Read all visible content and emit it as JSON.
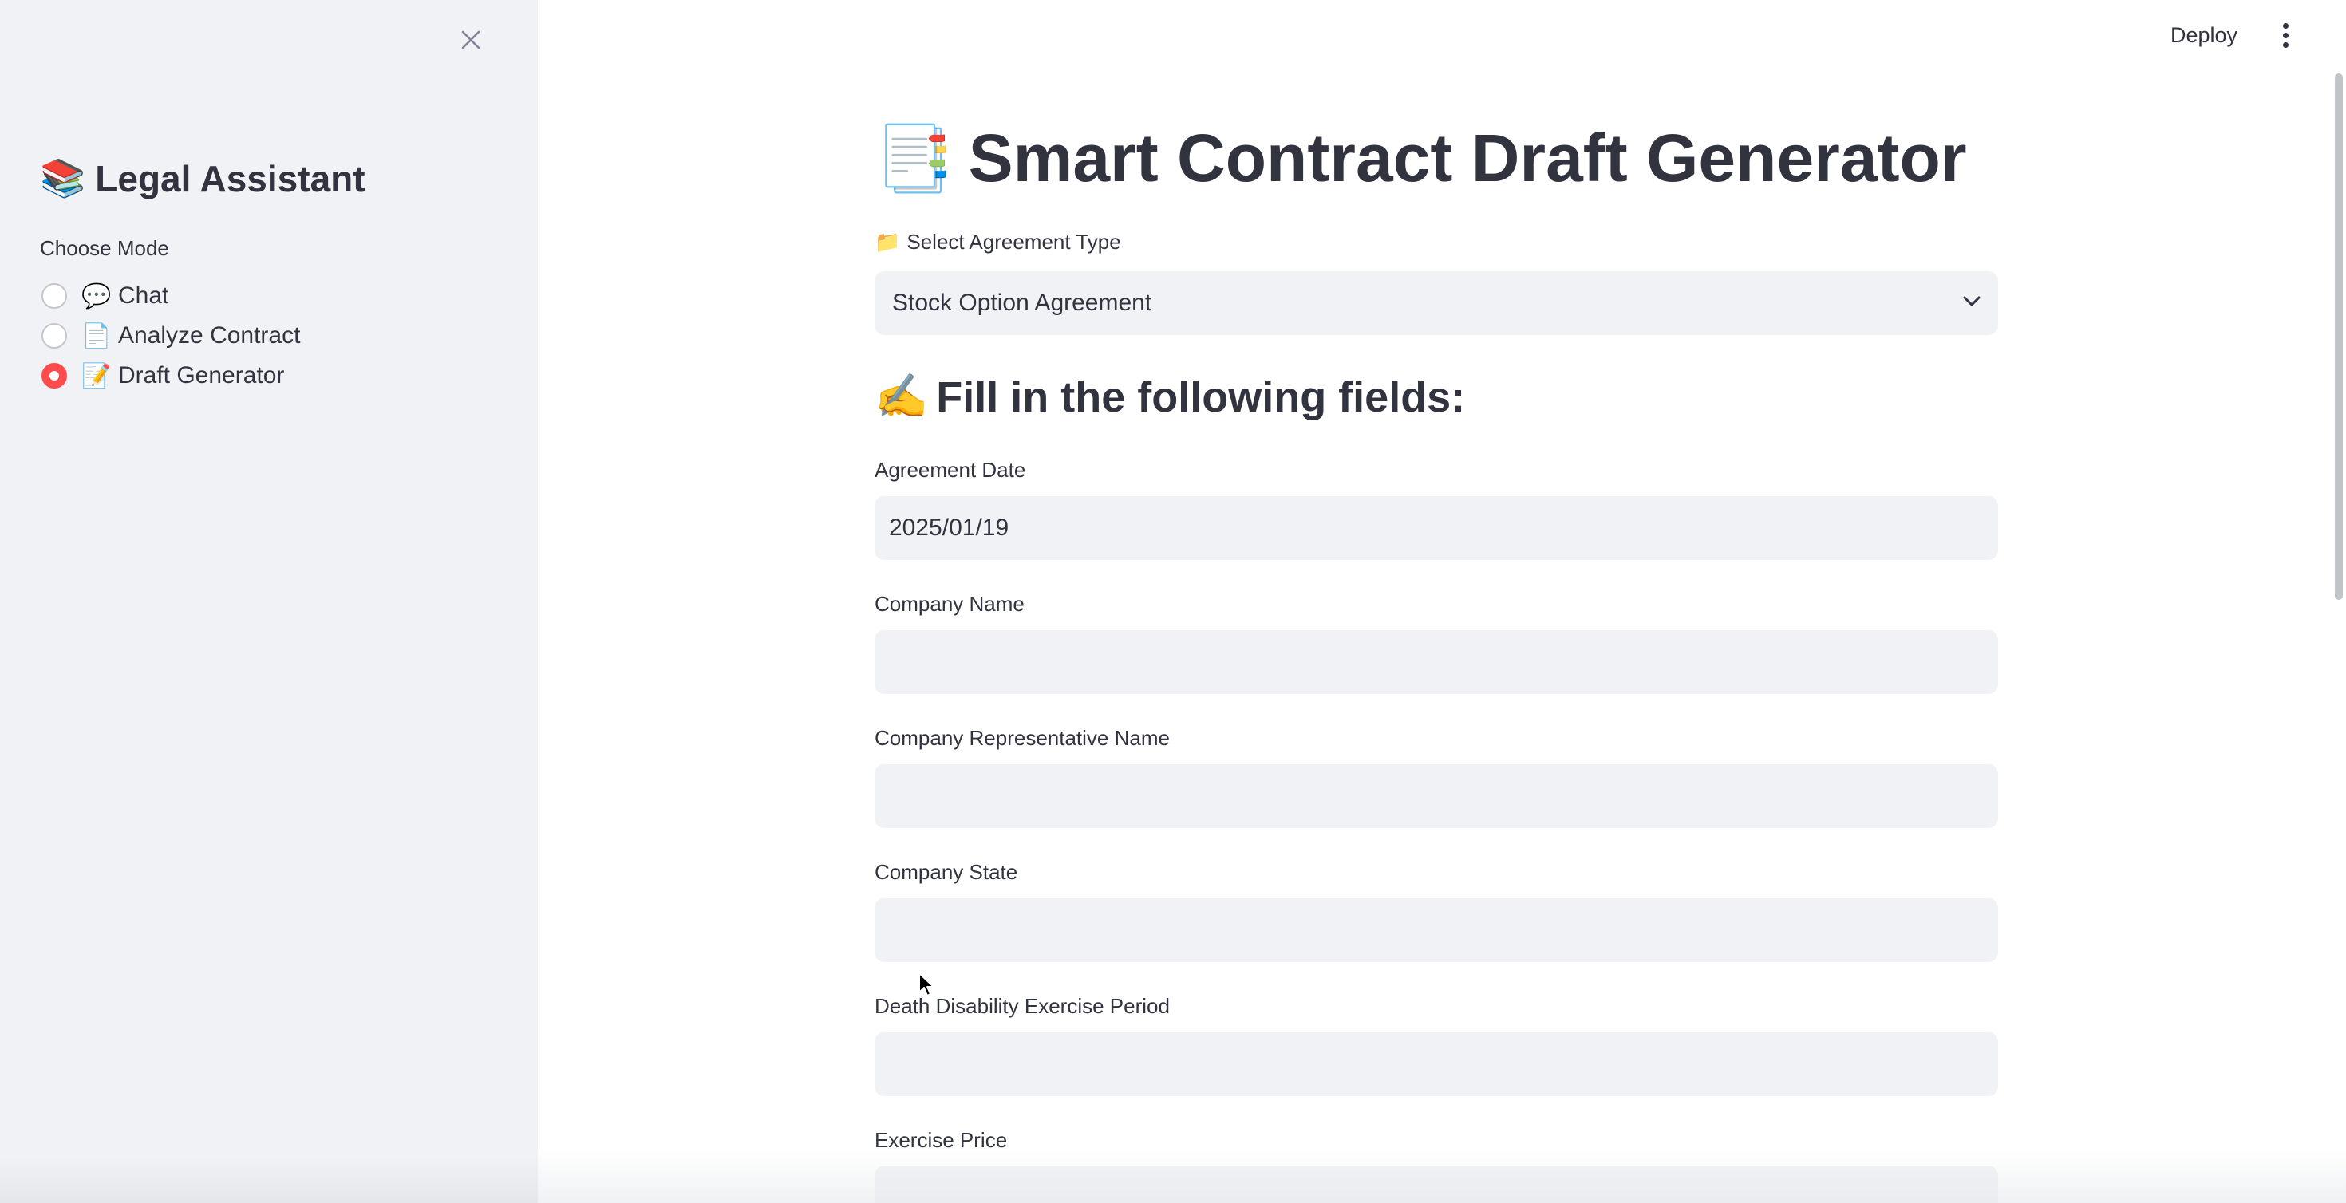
{
  "sidebar": {
    "title_emoji": "📚",
    "title": "Legal Assistant",
    "mode_label": "Choose Mode",
    "modes": [
      {
        "emoji": "💬",
        "label": "Chat",
        "selected": false
      },
      {
        "emoji": "📄",
        "label": "Analyze Contract",
        "selected": false
      },
      {
        "emoji": "📝",
        "label": "Draft Generator",
        "selected": true
      }
    ],
    "close_icon": "close-icon"
  },
  "header": {
    "deploy_label": "Deploy",
    "menu_icon": "vertical-dots-icon"
  },
  "main": {
    "title_emoji": "📑",
    "title": "Smart Contract Draft Generator",
    "select": {
      "label_emoji": "📁",
      "label": "Select Agreement Type",
      "value": "Stock Option Agreement"
    },
    "section_emoji": "✍️",
    "section_heading": "Fill in the following fields:",
    "fields": [
      {
        "label": "Agreement Date",
        "value": "2025/01/19"
      },
      {
        "label": "Company Name",
        "value": ""
      },
      {
        "label": "Company Representative Name",
        "value": ""
      },
      {
        "label": "Company State",
        "value": ""
      },
      {
        "label": "Death Disability Exercise Period",
        "value": ""
      },
      {
        "label": "Exercise Price",
        "value": ""
      }
    ]
  },
  "colors": {
    "accent": "#ff4b4b",
    "sidebar_bg": "#f0f2f6",
    "input_bg": "#f0f2f6",
    "text": "#31333f"
  }
}
